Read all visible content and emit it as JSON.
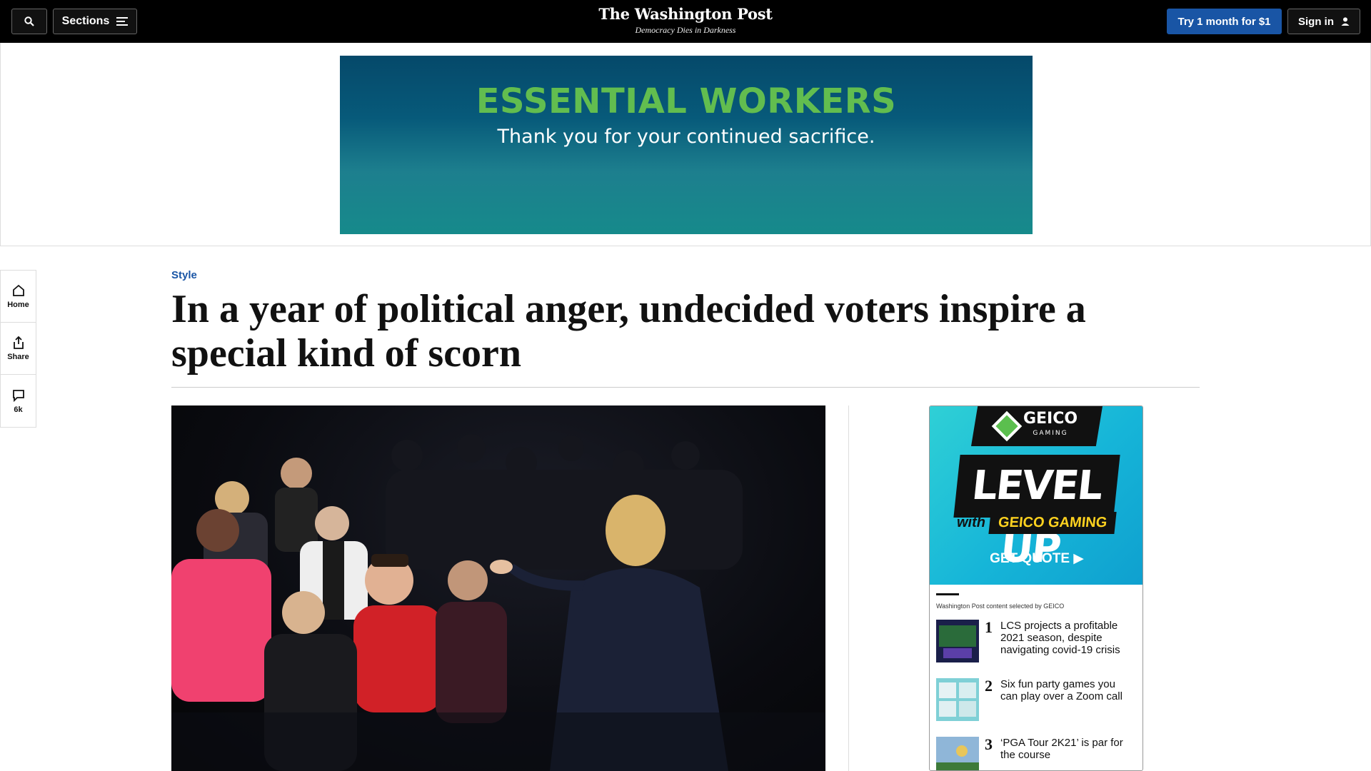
{
  "header": {
    "sections_label": "Sections",
    "logo": "The Washington Post",
    "tagline": "Democracy Dies in Darkness",
    "trial_label": "Try 1 month for $1",
    "signin_label": "Sign in"
  },
  "ad_banner": {
    "headline": "ESSENTIAL WORKERS",
    "subline": "Thank you for your continued sacrifice."
  },
  "rail": {
    "home_label": "Home",
    "share_label": "Share",
    "comments_label": "6k"
  },
  "article": {
    "section": "Style",
    "headline": "In a year of political anger, undecided voters inspire a special kind of scorn"
  },
  "sidebar_ad": {
    "brand": "GEICO",
    "brand_sub": "GAMING",
    "level_up": "LEVEL UP",
    "with_word": "with",
    "gaming_label": "GEICO GAMING",
    "cta": "GET QUOTE ▶",
    "selected_note": "Washington Post content selected by GEICO",
    "stories": [
      {
        "rank": "1",
        "title": "LCS projects a profitable 2021 season, despite navigating covid-19 crisis"
      },
      {
        "rank": "2",
        "title": "Six fun party games you can play over a Zoom call"
      },
      {
        "rank": "3",
        "title": "‘PGA Tour 2K21’ is par for the course"
      }
    ]
  },
  "colors": {
    "top_bar": "#000000",
    "accent_blue": "#1955a5",
    "ad_green": "#62bd4f",
    "ad_teal": "#168a8b"
  }
}
